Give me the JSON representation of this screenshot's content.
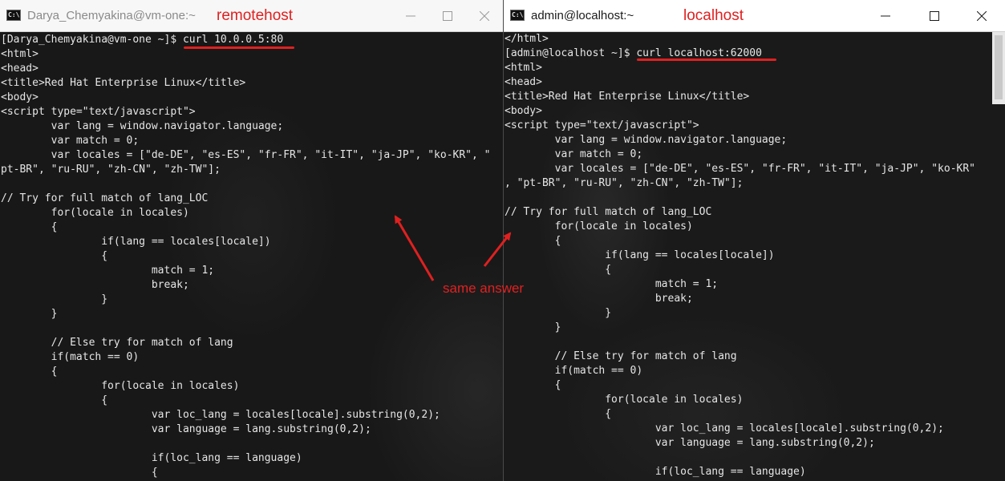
{
  "left_window": {
    "title": "Darya_Chemyakina@vm-one:~",
    "annotation": "remotehost",
    "icon": "cmd-icon",
    "controls": [
      "minimize-icon",
      "maximize-icon",
      "close-icon"
    ],
    "terminal_output": "[Darya_Chemyakina@vm-one ~]$ curl 10.0.0.5:80\n<html>\n<head>\n<title>Red Hat Enterprise Linux</title>\n<body>\n<script type=\"text/javascript\">\n        var lang = window.navigator.language;\n        var match = 0;\n        var locales = [\"de-DE\", \"es-ES\", \"fr-FR\", \"it-IT\", \"ja-JP\", \"ko-KR\", \"\npt-BR\", \"ru-RU\", \"zh-CN\", \"zh-TW\"];\n\n// Try for full match of lang_LOC\n        for(locale in locales)\n        {\n                if(lang == locales[locale])\n                {\n                        match = 1;\n                        break;\n                }\n        }\n\n        // Else try for match of lang\n        if(match == 0)\n        {\n                for(locale in locales)\n                {\n                        var loc_lang = locales[locale].substring(0,2);\n                        var language = lang.substring(0,2);\n\n                        if(loc_lang == language)\n                        {"
  },
  "right_window": {
    "title": "admin@localhost:~",
    "annotation": "localhost",
    "icon": "cmd-icon",
    "controls": [
      "minimize-icon",
      "maximize-icon",
      "close-icon"
    ],
    "terminal_output": "</html>\n[admin@localhost ~]$ curl localhost:62000\n<html>\n<head>\n<title>Red Hat Enterprise Linux</title>\n<body>\n<script type=\"text/javascript\">\n        var lang = window.navigator.language;\n        var match = 0;\n        var locales = [\"de-DE\", \"es-ES\", \"fr-FR\", \"it-IT\", \"ja-JP\", \"ko-KR\"\n, \"pt-BR\", \"ru-RU\", \"zh-CN\", \"zh-TW\"];\n\n// Try for full match of lang_LOC\n        for(locale in locales)\n        {\n                if(lang == locales[locale])\n                {\n                        match = 1;\n                        break;\n                }\n        }\n\n        // Else try for match of lang\n        if(match == 0)\n        {\n                for(locale in locales)\n                {\n                        var loc_lang = locales[locale].substring(0,2);\n                        var language = lang.substring(0,2);\n\n                        if(loc_lang == language)"
  },
  "annotation": {
    "label": "same answer",
    "color": "#e02020"
  },
  "colors": {
    "terminal_bg": "#1b1b1b",
    "terminal_text": "#e6e6e6",
    "annotation_red": "#e02020"
  }
}
